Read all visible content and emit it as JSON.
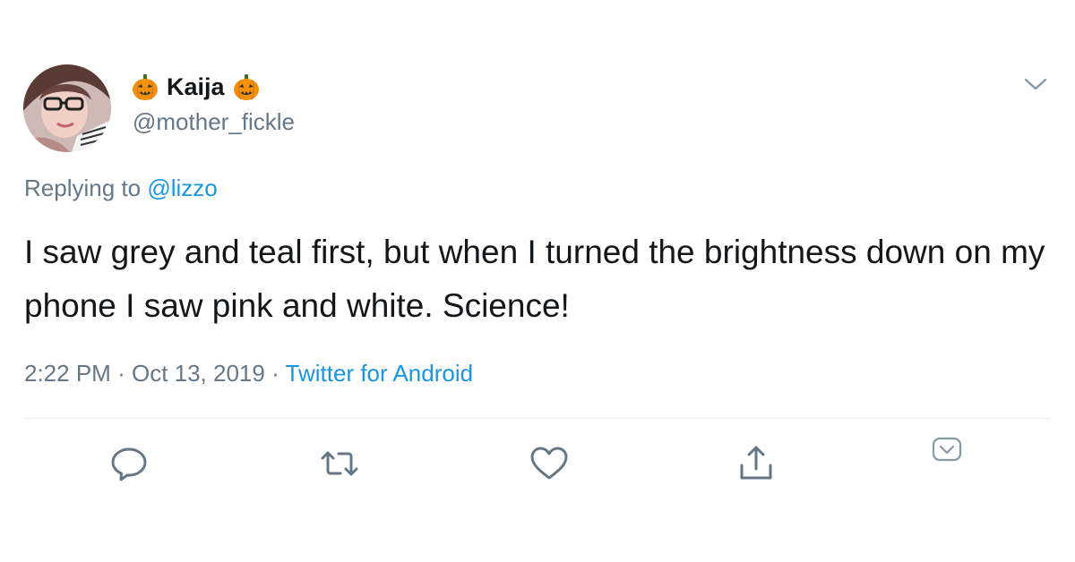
{
  "author": {
    "display_name": "Kaija",
    "handle": "@mother_fickle",
    "name_emoji": "jack-o-lantern-icon"
  },
  "reply": {
    "prefix": "Replying to ",
    "mention": "@lizzo"
  },
  "tweet": {
    "text": "I saw grey and teal first, but when I turned the brightness down on my phone I saw pink and white. Science!",
    "time": "2:22 PM",
    "date": "Oct 13, 2019",
    "separator": "·",
    "source": "Twitter for Android"
  },
  "actions": [
    {
      "icon": "reply-icon"
    },
    {
      "icon": "retweet-icon"
    },
    {
      "icon": "like-icon"
    },
    {
      "icon": "share-icon"
    },
    {
      "icon": "more-actions-icon"
    }
  ],
  "colors": {
    "text_primary": "#14171a",
    "text_secondary": "#657786",
    "link_blue": "#1b95e0",
    "divider": "#e6ecf0",
    "pumpkin_orange": "#f4900c"
  }
}
